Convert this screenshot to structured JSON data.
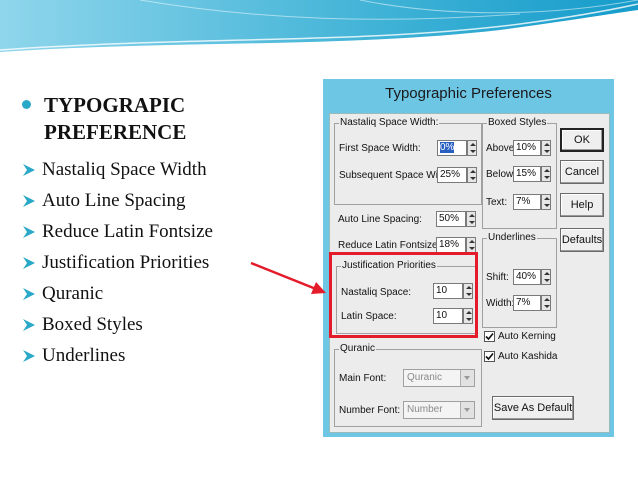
{
  "theme": {
    "accent": "#2aa8c8",
    "callout": "#e41b2b",
    "dialog_frame": "#6ec6e5",
    "selection": "#2a5fc2"
  },
  "slide": {
    "title": "TYPOGRAPIC PREFERENCE",
    "bullets": [
      "Nastaliq Space Width",
      "Auto Line Spacing",
      "Reduce Latin Fontsize",
      "Justification Priorities",
      "Quranic",
      "Boxed Styles",
      "Underlines"
    ]
  },
  "dialog": {
    "title": "Typographic Preferences",
    "nastaliq": {
      "group_label": "Nastaliq Space Width:",
      "first_label": "First Space Width:",
      "first_value": "0%",
      "subsequent_label": "Subsequent Space Width:",
      "subsequent_value": "25%"
    },
    "auto_line": {
      "label": "Auto Line Spacing:",
      "value": "50%"
    },
    "reduce_latin": {
      "label": "Reduce Latin Fontsize:",
      "value": "18%"
    },
    "justification": {
      "group_label": "Justification Priorities",
      "nastaliq_label": "Nastaliq Space:",
      "nastaliq_value": "10",
      "latin_label": "Latin Space:",
      "latin_value": "10"
    },
    "quranic": {
      "group_label": "Quranic",
      "main_label": "Main Font:",
      "main_value": "Quranic",
      "number_label": "Number Font:",
      "number_value": "Number"
    },
    "boxed": {
      "group_label": "Boxed Styles",
      "above_label": "Above:",
      "above_value": "10%",
      "below_label": "Below:",
      "below_value": "15%",
      "text_label": "Text:",
      "text_value": "7%"
    },
    "underlines": {
      "group_label": "Underlines",
      "shift_label": "Shift:",
      "shift_value": "40%",
      "width_label": "Width:",
      "width_value": "7%"
    },
    "auto_kerning": {
      "label": "Auto Kerning",
      "checked": true
    },
    "auto_kashida": {
      "label": "Auto Kashida",
      "checked": true
    },
    "buttons": {
      "ok": "OK",
      "cancel": "Cancel",
      "help": "Help",
      "defaults": "Defaults",
      "save_default": "Save As Default"
    }
  }
}
